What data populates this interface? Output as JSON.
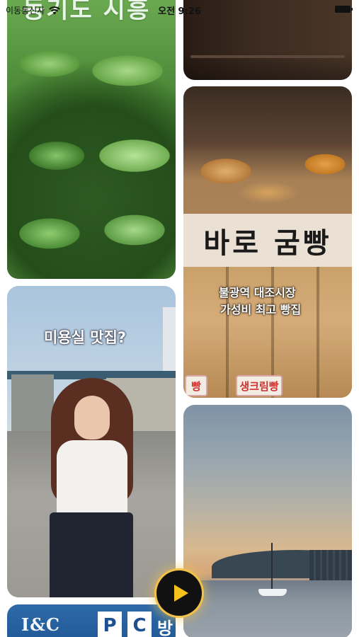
{
  "status_bar": {
    "carrier": "이동통신사",
    "time": "오전 9:26",
    "icons": [
      "wifi-icon",
      "battery-icon"
    ]
  },
  "feed": {
    "cards": [
      {
        "id": "leaves",
        "overlay_text": "동기도 시흥"
      },
      {
        "id": "dark",
        "overlay_text": ""
      },
      {
        "id": "bakery",
        "title": "바로 굼빵",
        "subtitle_line1": "불광역 대조시장",
        "subtitle_line2": "가성비 최고 빵집",
        "tag_left": "빵",
        "tag_mid": "생크림빵"
      },
      {
        "id": "person",
        "overlay_text": "미용실 맛집?"
      },
      {
        "id": "sunset",
        "overlay_text": ""
      },
      {
        "id": "sign",
        "sign_text": "I&C",
        "sign_p": "P",
        "sign_c": "C",
        "sign_bang": "방"
      }
    ]
  },
  "play_button": {
    "icon": "play-icon",
    "accent_color": "#f4c21b"
  }
}
